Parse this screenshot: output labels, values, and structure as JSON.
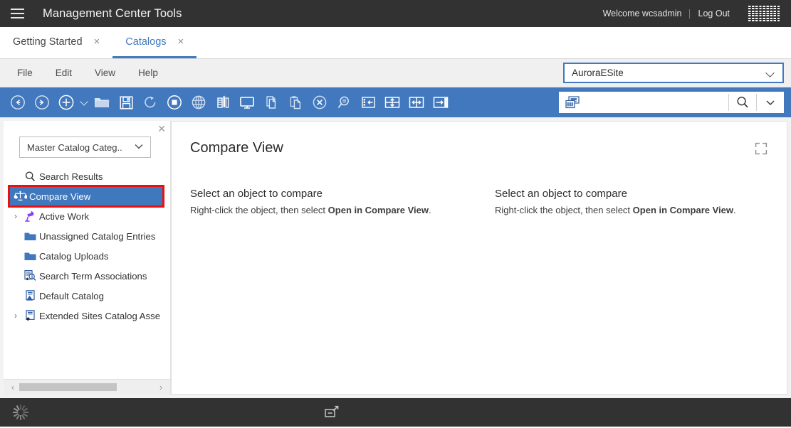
{
  "header": {
    "menu_icon": "hamburger-icon",
    "title": "Management Center Tools",
    "welcome": "Welcome wcsadmin",
    "logout": "Log Out",
    "logo": "ibm-logo"
  },
  "tabs": [
    {
      "label": "Getting Started",
      "active": false,
      "close": "×"
    },
    {
      "label": "Catalogs",
      "active": true,
      "close": "×"
    }
  ],
  "menubar": {
    "items": [
      "File",
      "Edit",
      "View",
      "Help"
    ],
    "store_selector": {
      "value": "AuroraESite",
      "icon": "chevron-down-icon"
    }
  },
  "toolbar": {
    "buttons": [
      {
        "name": "back-button",
        "icon": "arrow-left-circle-icon"
      },
      {
        "name": "forward-button",
        "icon": "arrow-right-circle-icon"
      },
      {
        "name": "new-button",
        "icon": "plus-circle-icon"
      },
      {
        "name": "new-dropdown",
        "icon": "chevron-down-icon"
      },
      {
        "name": "open-button",
        "icon": "folder-icon"
      },
      {
        "name": "save-button",
        "icon": "floppy-disk-icon"
      },
      {
        "name": "refresh-button",
        "icon": "refresh-icon"
      },
      {
        "name": "stop-button",
        "icon": "stop-circle-icon"
      },
      {
        "name": "globalization-button",
        "icon": "globe-icon"
      },
      {
        "name": "list-button",
        "icon": "list-ruler-icon"
      },
      {
        "name": "preview-button",
        "icon": "monitor-icon"
      },
      {
        "name": "copy-button",
        "icon": "copy-icon"
      },
      {
        "name": "paste-button",
        "icon": "paste-icon"
      },
      {
        "name": "delete-button",
        "icon": "delete-circle-icon"
      },
      {
        "name": "find-button",
        "icon": "magnifier-equals-icon"
      },
      {
        "name": "find-in-tree-button",
        "icon": "tree-locate-icon"
      },
      {
        "name": "split-horizontal-button",
        "icon": "split-horizontal-icon"
      },
      {
        "name": "split-vertical-button",
        "icon": "split-vertical-icon"
      },
      {
        "name": "show-panel-button",
        "icon": "show-panel-icon"
      }
    ],
    "search": {
      "value": "",
      "placeholder": "",
      "left_icon": "catalog-search-icon",
      "search_icon": "search-icon",
      "dropdown_icon": "chevron-down-icon"
    }
  },
  "explorer": {
    "close_icon": "close-icon",
    "catalog_selector": {
      "value": "Master Catalog Categ..",
      "icon": "chevron-down-icon"
    },
    "items": [
      {
        "label": "Search Results",
        "icon": "search-icon",
        "expandable": false,
        "selected": false,
        "highlighted": false
      },
      {
        "label": "Compare View",
        "icon": "compare-scales-icon",
        "expandable": false,
        "selected": true,
        "highlighted": true
      },
      {
        "label": "Active Work",
        "icon": "active-work-icon",
        "expandable": true,
        "selected": false,
        "highlighted": false
      },
      {
        "label": "Unassigned Catalog Entries",
        "icon": "folder-icon",
        "expandable": false,
        "selected": false,
        "highlighted": false
      },
      {
        "label": "Catalog Uploads",
        "icon": "folder-icon",
        "expandable": false,
        "selected": false,
        "highlighted": false
      },
      {
        "label": "Search Term Associations",
        "icon": "search-term-icon",
        "expandable": false,
        "selected": false,
        "highlighted": false
      },
      {
        "label": "Default Catalog",
        "icon": "catalog-icon",
        "expandable": false,
        "selected": false,
        "highlighted": false
      },
      {
        "label": "Extended Sites Catalog Asse",
        "icon": "catalog-asset-icon",
        "expandable": true,
        "selected": false,
        "highlighted": false
      }
    ],
    "scrollbar": {
      "left_arrow": "‹",
      "right_arrow": "›"
    }
  },
  "content": {
    "title": "Compare View",
    "expand_icon": "expand-icon",
    "left_pane": {
      "heading": "Select an object to compare",
      "hint_prefix": "Right-click the object, then select ",
      "hint_bold": "Open in Compare View",
      "hint_suffix": "."
    },
    "right_pane": {
      "heading": "Select an object to compare",
      "hint_prefix": "Right-click the object, then select ",
      "hint_bold": "Open in Compare View",
      "hint_suffix": "."
    }
  },
  "statusbar": {
    "spinner": "loading-spinner-icon",
    "detach_icon": "detach-window-icon"
  },
  "colors": {
    "header_bg": "#323232",
    "toolbar_blue": "#4178be",
    "accent_blue": "#4178be",
    "selection_blue": "#3f78bd",
    "highlight_red": "#e81010",
    "folder_blue": "#3f78bd",
    "purple": "#8a3ffc"
  }
}
